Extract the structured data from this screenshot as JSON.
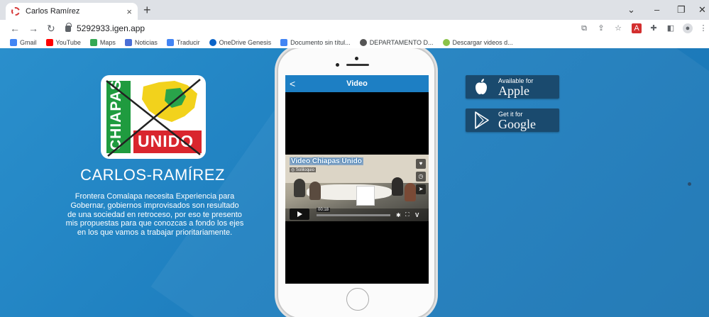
{
  "browser": {
    "tab_title": "Carlos Ramírez",
    "tab_close": "×",
    "new_tab": "+",
    "url": "5292933.igen.app",
    "window_controls": {
      "dropdown": "⌄",
      "minimize": "–",
      "restore": "❐",
      "close": "✕"
    },
    "bookmarks": [
      {
        "label": "Gmail",
        "icon": "google-icon",
        "color": "#4285f4"
      },
      {
        "label": "YouTube",
        "icon": "youtube-icon",
        "color": "#ff0000"
      },
      {
        "label": "Maps",
        "icon": "maps-icon",
        "color": "#34a853"
      },
      {
        "label": "Noticias",
        "icon": "news-icon",
        "color": "#4a6fd6"
      },
      {
        "label": "Traducir",
        "icon": "translate-icon",
        "color": "#4285f4"
      },
      {
        "label": "OneDrive Genesis",
        "icon": "onedrive-icon",
        "color": "#0a64c8"
      },
      {
        "label": "Documento sin títul...",
        "icon": "docs-icon",
        "color": "#4285f4"
      },
      {
        "label": "DEPARTAMENTO D...",
        "icon": "globe-icon",
        "color": "#555555"
      },
      {
        "label": "Descargar videos d...",
        "icon": "leaf-icon",
        "color": "#8bc34a"
      }
    ]
  },
  "page": {
    "logo": {
      "vertical_text": "CHIAPAS",
      "unido_text": "UNIDO"
    },
    "candidate_name": "CARLOS-RAMÍREZ",
    "description": "Frontera Comalapa necesita Experiencia para Gobernar, gobiernos improvisados son resultado de una sociedad en retroceso, por eso te presento mis propuestas para que conozcas a fondo los ejes en los que vamos a trabajar prioritariamente.",
    "phone": {
      "app_title": "Video",
      "back": "<",
      "video": {
        "title": "Video Chiapas Unido",
        "brand": "◎ Soliloquio",
        "time": "00:18"
      }
    },
    "stores": {
      "apple": {
        "small": "Available for",
        "big": "Apple"
      },
      "google": {
        "small": "Get it for",
        "big": "Google"
      }
    }
  },
  "colors": {
    "page_bg": "#2087c6",
    "store_bg": "#1a4a6e",
    "logo_green": "#1f9b3f",
    "logo_red": "#d9262e"
  }
}
